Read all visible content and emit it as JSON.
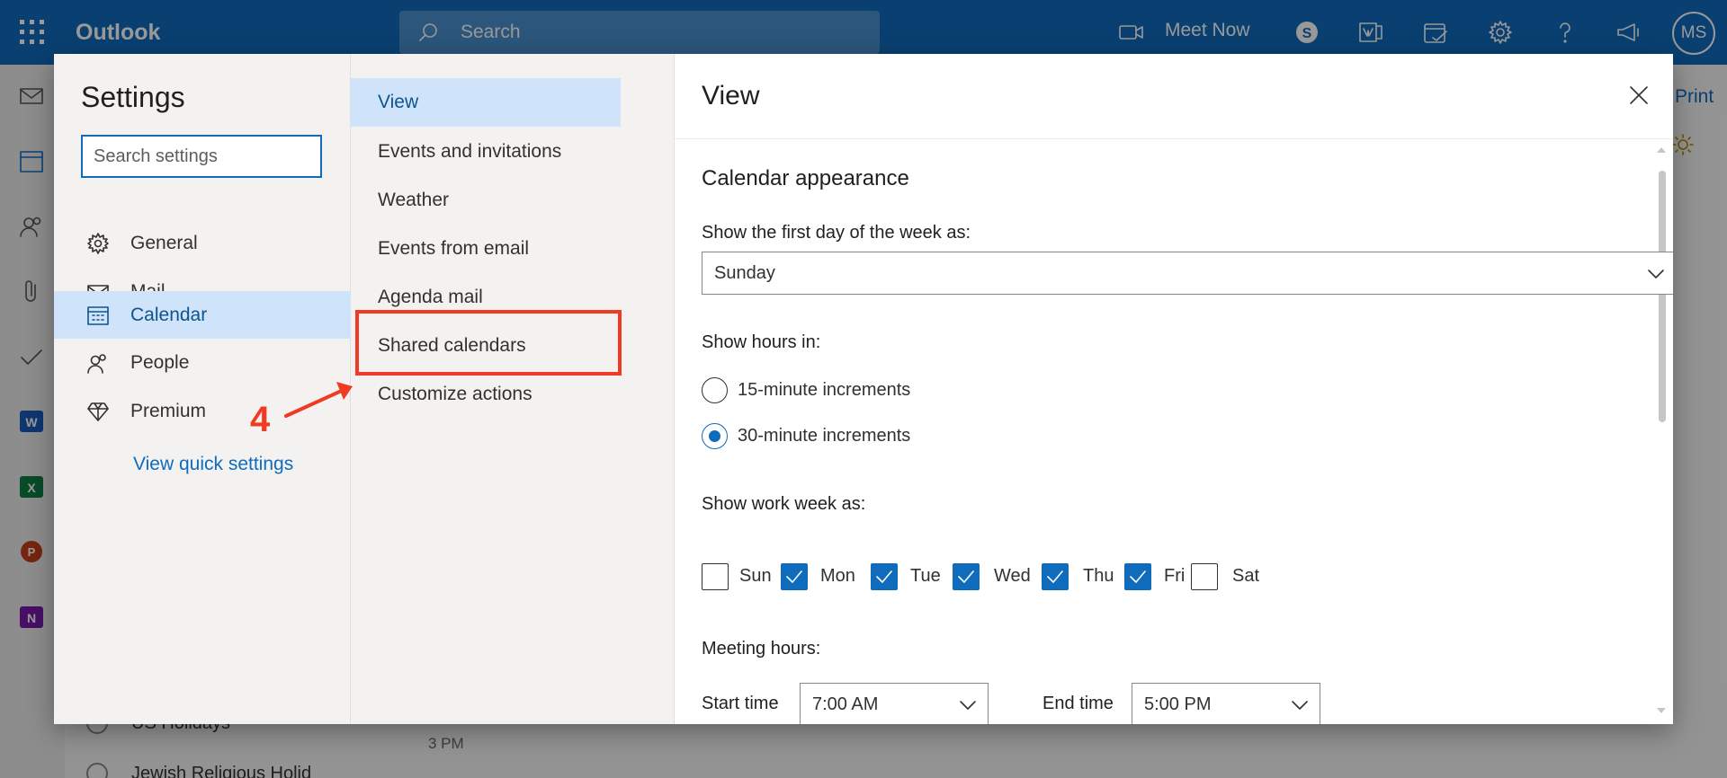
{
  "app": {
    "name": "Outlook"
  },
  "header": {
    "search_placeholder": "Search",
    "meet_now": "Meet Now",
    "avatar_initials": "MS"
  },
  "background": {
    "print_label": "Print",
    "calendar_items": [
      "US Holidays",
      "Jewish Religious Holid"
    ],
    "time_label": "3 PM"
  },
  "settings": {
    "title": "Settings",
    "search_placeholder": "Search settings",
    "categories": [
      {
        "label": "General",
        "icon": "gear-icon"
      },
      {
        "label": "Mail",
        "icon": "mail-icon"
      },
      {
        "label": "Calendar",
        "icon": "calendar-icon",
        "active": true
      },
      {
        "label": "People",
        "icon": "people-icon"
      },
      {
        "label": "Premium",
        "icon": "diamond-icon"
      }
    ],
    "quick_settings": "View quick settings",
    "subnav": [
      {
        "label": "View",
        "active": true
      },
      {
        "label": "Events and invitations"
      },
      {
        "label": "Weather"
      },
      {
        "label": "Events from email"
      },
      {
        "label": "Agenda mail"
      },
      {
        "label": "Shared calendars",
        "highlighted": true
      },
      {
        "label": "Customize actions"
      }
    ],
    "annotation": {
      "step": "4",
      "color": "#ef3b24"
    }
  },
  "view": {
    "title": "View",
    "section_title": "Calendar appearance",
    "first_day_label": "Show the first day of the week as:",
    "first_day_value": "Sunday",
    "hours_label": "Show hours in:",
    "hours_options": [
      {
        "label": "15-minute increments",
        "checked": false
      },
      {
        "label": "30-minute increments",
        "checked": true
      }
    ],
    "work_week_label": "Show work week as:",
    "days": [
      {
        "label": "Sun",
        "checked": false
      },
      {
        "label": "Mon",
        "checked": true
      },
      {
        "label": "Tue",
        "checked": true
      },
      {
        "label": "Wed",
        "checked": true
      },
      {
        "label": "Thu",
        "checked": true
      },
      {
        "label": "Fri",
        "checked": true
      },
      {
        "label": "Sat",
        "checked": false
      }
    ],
    "meeting_hours_label": "Meeting hours:",
    "start_time_label": "Start time",
    "start_time_value": "7:00 AM",
    "end_time_label": "End time",
    "end_time_value": "5:00 PM"
  },
  "colors": {
    "accent": "#0f6cbd",
    "annotation": "#ef3b24",
    "selected_bg": "#cfe4fa"
  }
}
